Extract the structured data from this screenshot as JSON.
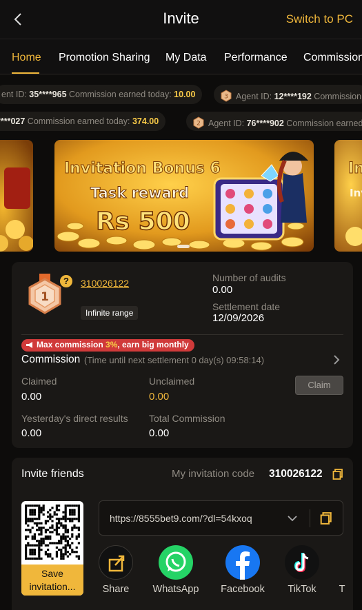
{
  "header": {
    "title": "Invite",
    "switch_label": "Switch to PC"
  },
  "tabs": [
    "Home",
    "Promotion Sharing",
    "My Data",
    "Performance",
    "Commission"
  ],
  "ticker": {
    "row1": [
      {
        "prefix": "ent ID: ",
        "id": "35****965",
        "mid": " Commission earned today: ",
        "amount": "10.00"
      },
      {
        "prefix": "Agent ID: ",
        "id": "12****192",
        "mid": " Commission",
        "amount": ""
      }
    ],
    "row2": [
      {
        "prefix": "",
        "id": "****027",
        "mid": " Commission earned today: ",
        "amount": "374.00"
      },
      {
        "prefix": "Agent ID: ",
        "id": "76****902",
        "mid": " Commission earned",
        "amount": ""
      }
    ]
  },
  "banner": {
    "line1": "Invitation Bonus 6",
    "line2": "Task reward",
    "line3": "Rs 500",
    "right_peek": "In",
    "right_peek2": "Inv"
  },
  "agent": {
    "level": "1",
    "code": "310026122",
    "range_badge": "Infinite range",
    "audits_label": "Number of audits",
    "audits_value": "0.00",
    "settlement_label": "Settlement date",
    "settlement_value": "12/09/2026"
  },
  "commission": {
    "promo_prefix": "Max commission ",
    "promo_pct": "3%",
    "promo_suffix": ", earn big monthly",
    "title": "Commission",
    "subtitle": "(Time until next settlement  0 day(s) 09:58:14)",
    "claimed_label": "Claimed",
    "claimed_value": "0.00",
    "unclaimed_label": "Unclaimed",
    "unclaimed_value": "0.00",
    "claim_button": "Claim",
    "yesterday_label": "Yesterday's direct results",
    "yesterday_value": "0.00",
    "total_label": "Total Commission",
    "total_value": "0.00"
  },
  "invite": {
    "title": "Invite friends",
    "code_label": "My invitation code",
    "code_value": "310026122",
    "save_label_1": "Save",
    "save_label_2": "invitation...",
    "link": "https://8555bet9.com/?dl=54kxoq",
    "share": [
      "Share",
      "WhatsApp",
      "Facebook",
      "TikTok",
      "T"
    ]
  },
  "colors": {
    "accent": "#f0b73b",
    "background": "#0d0c0b",
    "card": "#1a1816",
    "whatsapp": "#25d366",
    "facebook": "#1877f2",
    "promo_red": "#d03a3a"
  },
  "icons": [
    "back-arrow-icon",
    "medal-icon",
    "question-icon",
    "chevron-right-icon",
    "megaphone-icon",
    "copy-icon",
    "chevron-down-icon",
    "share-icon",
    "whatsapp-icon",
    "facebook-icon",
    "tiktok-icon",
    "qr-code-icon"
  ]
}
